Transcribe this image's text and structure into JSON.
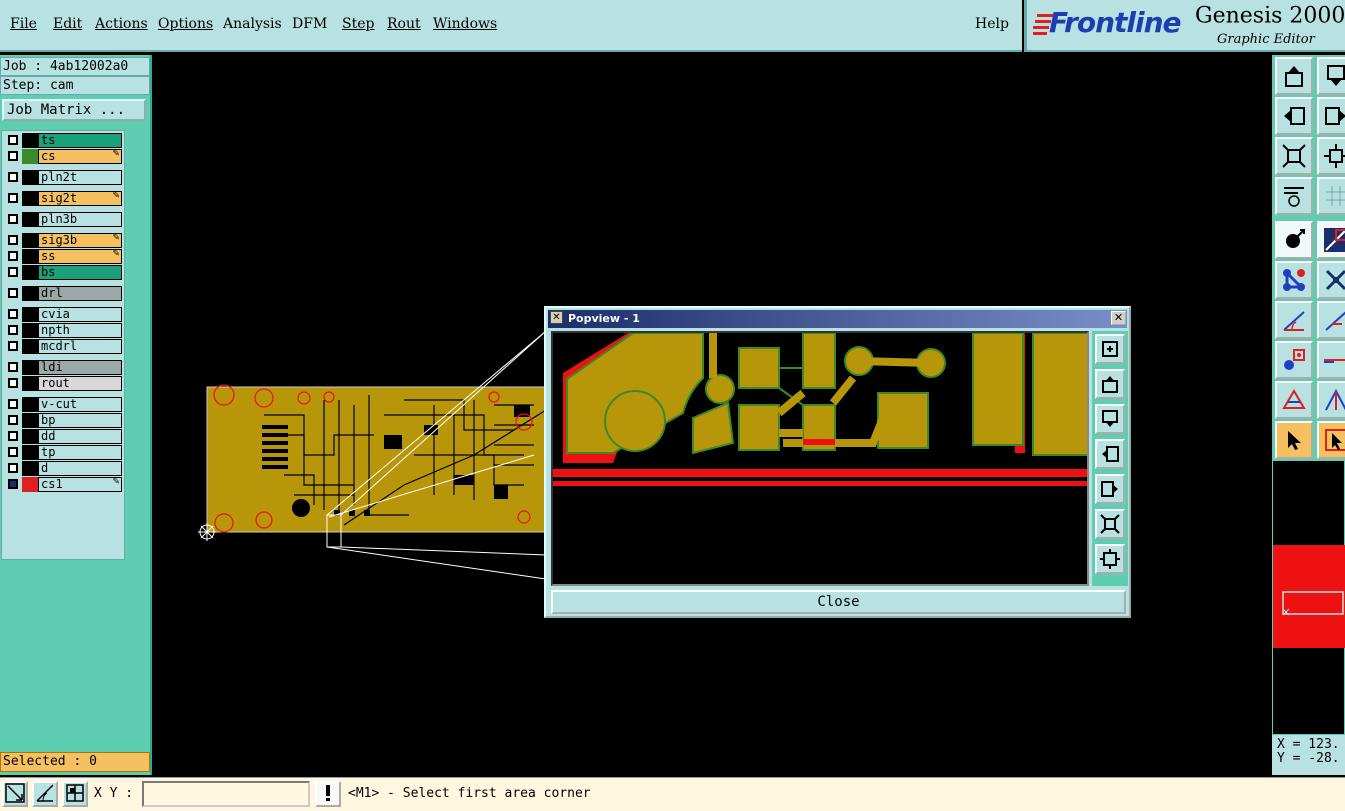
{
  "menu": {
    "items": [
      "File",
      "Edit",
      "Actions",
      "Options",
      "Analysis",
      "DFM",
      "Step",
      "Rout",
      "Windows"
    ],
    "help": "Help"
  },
  "logo": {
    "brand": "Frontline",
    "product": "Genesis 2000",
    "product_suffix": "2",
    "subtitle": "Graphic Editor"
  },
  "job": {
    "job_line": "Job : 4ab12002a0",
    "step_line": "Step: cam",
    "matrix_button": "Job Matrix ..."
  },
  "layers": [
    {
      "name": "ts",
      "color": "#1aa07a",
      "swatch": "#000",
      "pen": false
    },
    {
      "name": "cs",
      "color": "#f4c060",
      "swatch": "#3a8a2a",
      "pen": true
    },
    {
      "name": "pln2t",
      "color": "#b8e2e2",
      "swatch": "#000",
      "pen": false
    },
    {
      "name": "sig2t",
      "color": "#f4c060",
      "swatch": "#000",
      "pen": true
    },
    {
      "name": "pln3b",
      "color": "#b8e2e2",
      "swatch": "#000",
      "pen": false
    },
    {
      "name": "sig3b",
      "color": "#f4c060",
      "swatch": "#000",
      "pen": true
    },
    {
      "name": "ss",
      "color": "#f4c060",
      "swatch": "#000",
      "pen": true
    },
    {
      "name": "bs",
      "color": "#1aa07a",
      "swatch": "#000",
      "pen": false
    },
    {
      "name": "drl",
      "color": "#9aa8a8",
      "swatch": "#000",
      "pen": false
    },
    {
      "name": "cvia",
      "color": "#b8e2e2",
      "swatch": "#000",
      "pen": false
    },
    {
      "name": "npth",
      "color": "#b8e2e2",
      "swatch": "#000",
      "pen": false
    },
    {
      "name": "mcdrl",
      "color": "#b8e2e2",
      "swatch": "#000",
      "pen": false
    },
    {
      "name": "ldi",
      "color": "#9aa8a8",
      "swatch": "#000",
      "pen": false
    },
    {
      "name": "rout",
      "color": "#d8d8d8",
      "swatch": "#000",
      "pen": false
    },
    {
      "name": "v-cut",
      "color": "#b8e2e2",
      "swatch": "#000",
      "pen": false
    },
    {
      "name": "bp",
      "color": "#b8e2e2",
      "swatch": "#000",
      "pen": false
    },
    {
      "name": "dd",
      "color": "#b8e2e2",
      "swatch": "#000",
      "pen": false
    },
    {
      "name": "tp",
      "color": "#b8e2e2",
      "swatch": "#000",
      "pen": false
    },
    {
      "name": "d",
      "color": "#b8e2e2",
      "swatch": "#000",
      "pen": false
    },
    {
      "name": "cs1",
      "color": "#b8e2e2",
      "swatch": "#e02020",
      "pen": true
    }
  ],
  "status": {
    "selected": "Selected : 0"
  },
  "bottom": {
    "xy_label": "X Y :",
    "xy_value": "",
    "prompt": "<M1> - Select first area corner"
  },
  "coords": {
    "x_line": "X = 123.",
    "y_line": "Y = -28."
  },
  "popup": {
    "title": "Popview - 1",
    "close_label": "Close"
  },
  "colors": {
    "copper": "#b8960a",
    "trace_outline": "#3a8a2a",
    "highlight": "#ee1111",
    "panel": "#b8e2e2",
    "panel_dark": "#5ecdb0"
  }
}
